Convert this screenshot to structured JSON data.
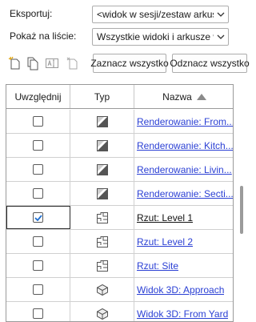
{
  "export": {
    "label": "Eksportuj:",
    "value": "<widok w sesji/zestaw arkuszy>"
  },
  "show": {
    "label": "Pokaż na liście:",
    "value": "Wszystkie widoki i arkusze w modelu"
  },
  "buttons": {
    "select_all": "Zaznacz wszystko",
    "deselect_all": "Odznacz wszystko"
  },
  "table": {
    "headers": {
      "include": "Uwzględnij",
      "type": "Typ",
      "name": "Nazwa"
    },
    "rows": [
      {
        "checked": false,
        "icon": "render-icon",
        "name": "Renderowanie: From..."
      },
      {
        "checked": false,
        "icon": "render-icon",
        "name": "Renderowanie: Kitch..."
      },
      {
        "checked": false,
        "icon": "render-icon",
        "name": "Renderowanie: Livin..."
      },
      {
        "checked": false,
        "icon": "render-icon",
        "name": "Renderowanie: Secti..."
      },
      {
        "checked": true,
        "icon": "floor-plan-icon",
        "name": "Rzut: Level 1"
      },
      {
        "checked": false,
        "icon": "floor-plan-icon",
        "name": "Rzut: Level 2"
      },
      {
        "checked": false,
        "icon": "floor-plan-icon",
        "name": "Rzut: Site"
      },
      {
        "checked": false,
        "icon": "3d-view-icon",
        "name": "Widok 3D: Approach"
      },
      {
        "checked": false,
        "icon": "3d-view-icon",
        "name": "Widok 3D: From Yard"
      }
    ]
  },
  "colors": {
    "link": "#2a3fd4",
    "check": "#1f6fd1"
  }
}
